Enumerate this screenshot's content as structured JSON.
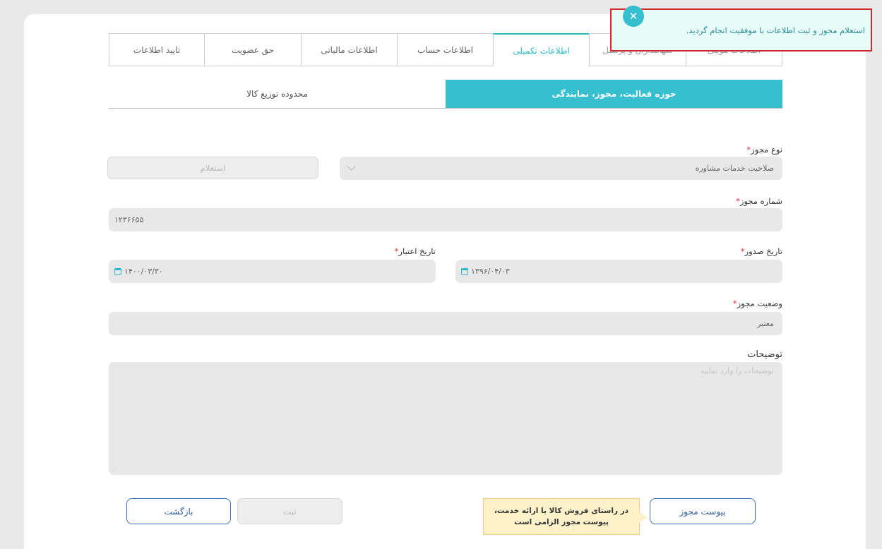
{
  "tabs": [
    {
      "label": "تایید اطلاعات"
    },
    {
      "label": "حق عضویت"
    },
    {
      "label": "اطلاعات مالیاتی"
    },
    {
      "label": "اطلاعات حساب"
    },
    {
      "label": "اطلاعات تکمیلی"
    },
    {
      "label": "سهامداران و پرسنل"
    },
    {
      "label": "اطلاعات هویتی"
    }
  ],
  "subtabs": [
    {
      "label": "محدوده توزیع کالا"
    },
    {
      "label": "حوزه فعالیت، مجوز، نمایندگی"
    }
  ],
  "form": {
    "license_type": {
      "label": "نوع مجوز",
      "value": "صلاحیت خدمات مشاوره"
    },
    "inquiry_button": "استعلام",
    "license_number": {
      "label": "شماره مجوز",
      "value": "۱۲۳۶۶۵۵"
    },
    "expiry_date": {
      "label": "تاریخ اعتبار",
      "value": "۱۴۰۰/۰۳/۳۰"
    },
    "issue_date": {
      "label": "تاریخ صدور",
      "value": "۱۳۹۶/۰۴/۰۳"
    },
    "license_status": {
      "label": "وضعیت مجوز",
      "value": "معتبر"
    },
    "description": {
      "label": "توضیحات",
      "placeholder": "توضیحات را وارد نمایید"
    },
    "required_mark": "*"
  },
  "buttons": {
    "attach": "پیوست مجوز",
    "submit": "ثبت",
    "back": "بازگشت"
  },
  "tooltip": {
    "line1": "در راستای فروش کالا یا ارائه خدمت،",
    "line2": "پیوست مجوز الزامی است"
  },
  "toast": {
    "message": "استعلام مجوز و ثبت اطلاعات با موفقیت انجام گردید.",
    "close_glyph": "✕"
  },
  "colors": {
    "accent": "#35bfcf",
    "primary": "#2c5d9e",
    "error_border": "#d22a2a",
    "required": "#e0303b"
  }
}
